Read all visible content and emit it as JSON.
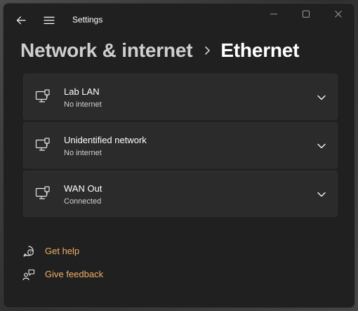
{
  "window": {
    "title": "Settings"
  },
  "breadcrumb": {
    "parent": "Network & internet",
    "current": "Ethernet"
  },
  "networks": [
    {
      "name": "Lab LAN",
      "status": "No internet",
      "icon": "ethernet-icon"
    },
    {
      "name": "Unidentified network",
      "status": "No internet",
      "icon": "ethernet-icon"
    },
    {
      "name": "WAN Out",
      "status": "Connected",
      "icon": "ethernet-icon"
    }
  ],
  "links": {
    "help": {
      "label": "Get help",
      "icon": "help-icon"
    },
    "feedback": {
      "label": "Give feedback",
      "icon": "feedback-icon"
    }
  },
  "colors": {
    "window_bg": "#202020",
    "card_bg": "#2b2b2b",
    "link_accent": "#f0b062"
  }
}
